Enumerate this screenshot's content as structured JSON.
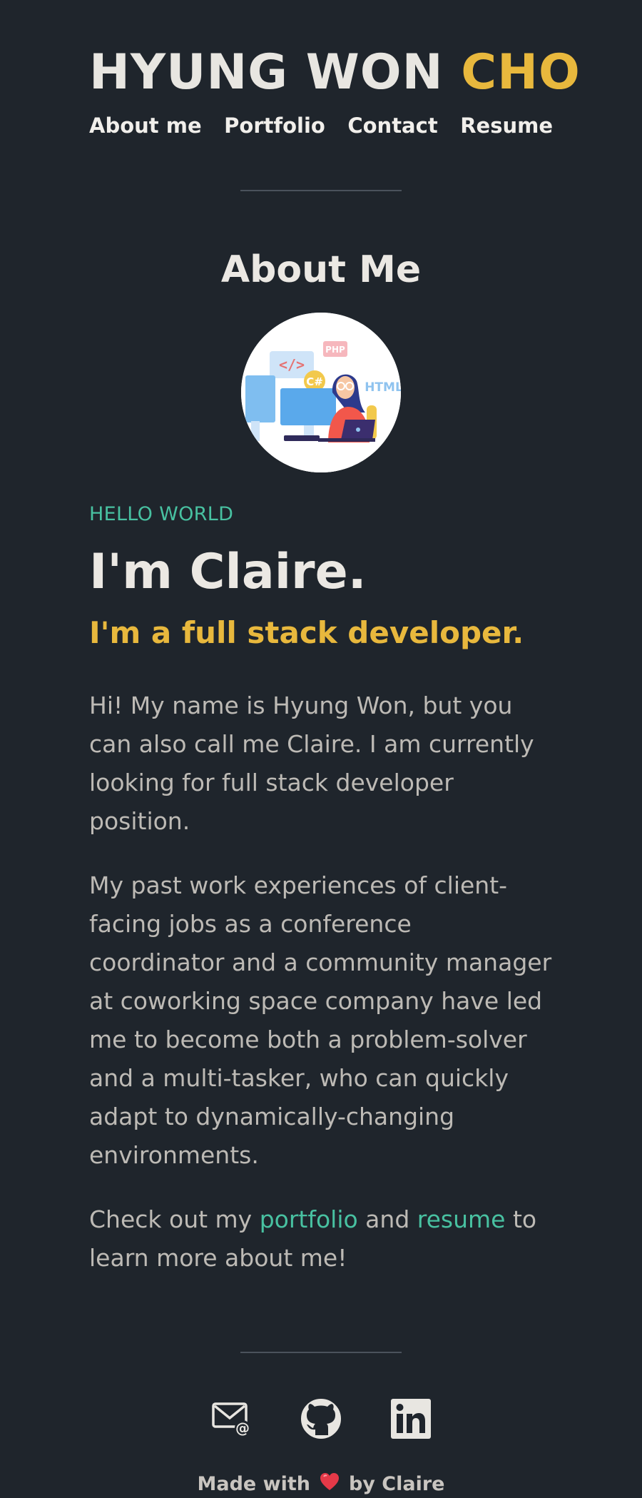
{
  "header": {
    "brand_first": "HYUNG WON",
    "brand_last": "CHO",
    "nav": [
      "About me",
      "Portfolio",
      "Contact",
      "Resume"
    ]
  },
  "about": {
    "title": "About Me",
    "avatar_badges": [
      "PHP",
      "</>",
      "C#",
      "HTML"
    ],
    "greeting": "HELLO WORLD",
    "name_line": "I'm Claire.",
    "role_line": "I'm a full stack developer.",
    "paragraph_1": "Hi! My name is Hyung Won, but you can also call me Claire. I am currently looking for full stack developer position.",
    "paragraph_2": "My past work experiences of client-facing jobs as a conference coordinator and a community manager at coworking space company have led me to become both a problem-solver and a multi-tasker, who can quickly adapt to dynamically-changing environments.",
    "cta": {
      "before": "Check out my ",
      "portfolio_link": "portfolio",
      "middle": " and ",
      "resume_link": "resume",
      "after": " to learn more about me!"
    }
  },
  "social": {
    "icons": [
      "email-icon",
      "github-icon",
      "linkedin-icon"
    ]
  },
  "footer": {
    "before": "Made with",
    "after": "by Claire"
  },
  "colors": {
    "background": "#1f252c",
    "accent_yellow": "#e8b83d",
    "accent_teal": "#48c1a1",
    "text": "#e8e6e1"
  }
}
